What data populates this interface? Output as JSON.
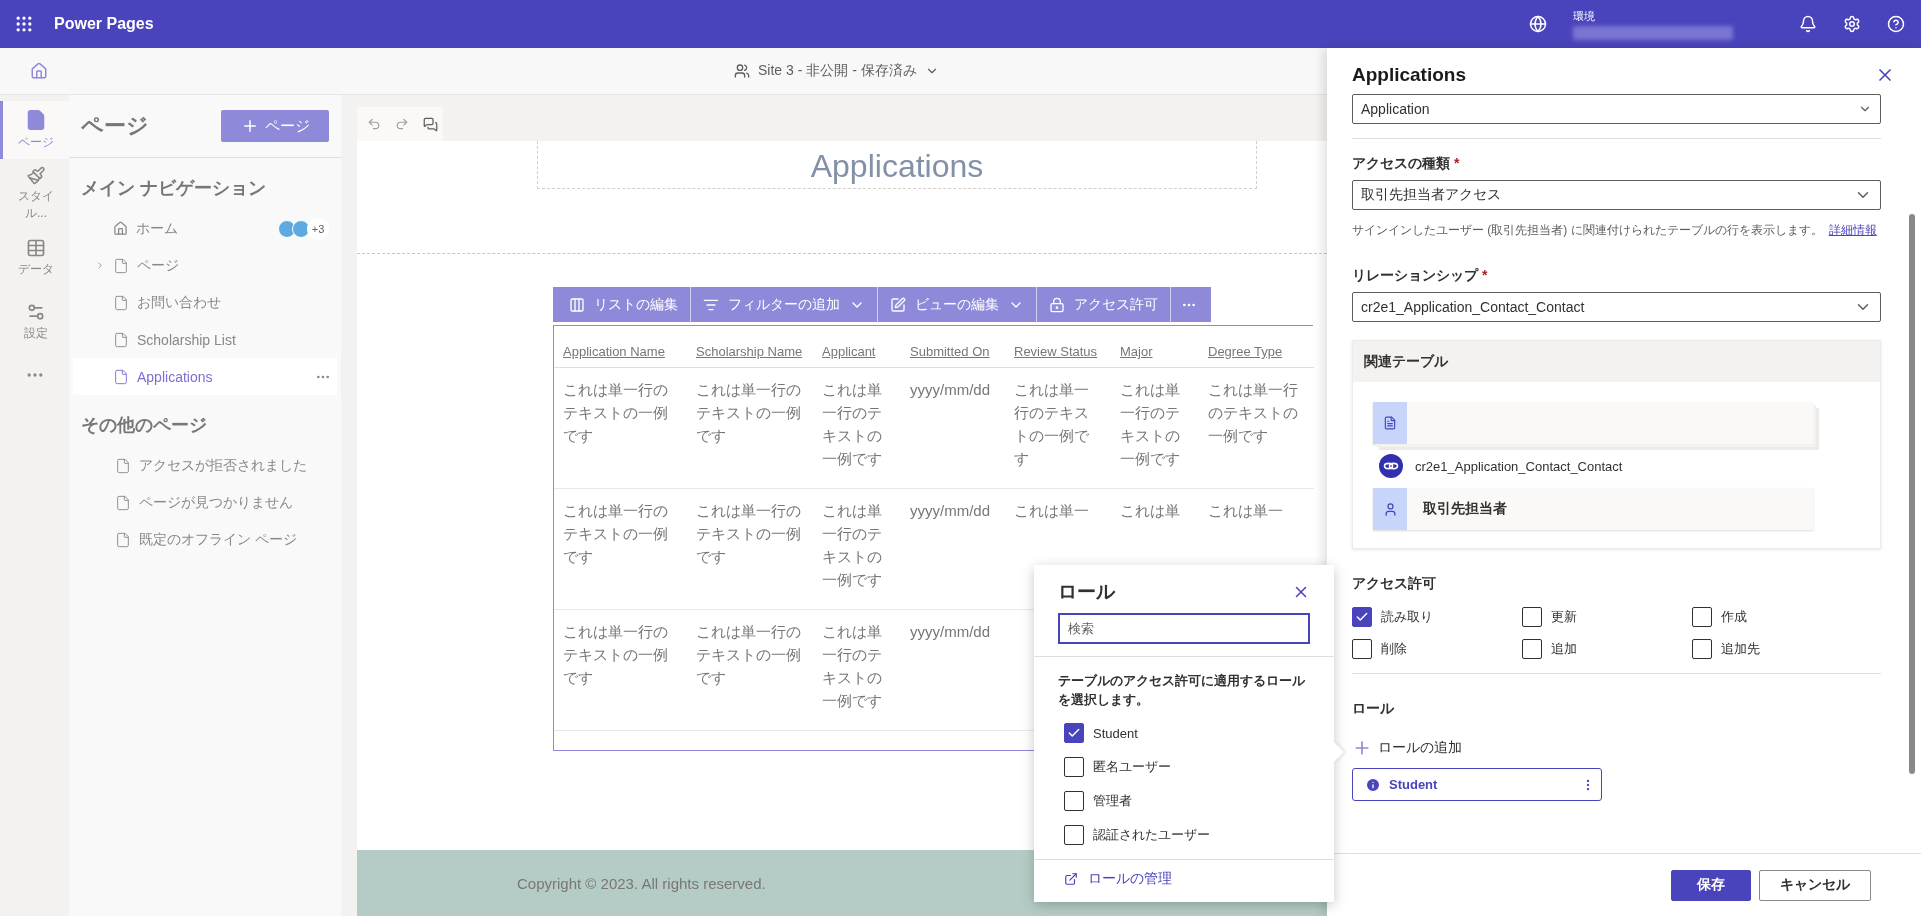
{
  "top_bar": {
    "app_title": "Power Pages",
    "environment_label": "環境"
  },
  "subheader": {
    "site_status": "Site 3 - 非公開 - 保存済み"
  },
  "rail": [
    {
      "label": "ページ",
      "selected": true
    },
    {
      "label": "スタイル...",
      "selected": false
    },
    {
      "label": "データ",
      "selected": false
    },
    {
      "label": "設定",
      "selected": false
    }
  ],
  "pages_panel": {
    "title": "ページ",
    "add_button": "ページ",
    "sections": [
      {
        "heading": "メイン ナビゲーション",
        "items": [
          {
            "label": "ホーム",
            "kind": "home",
            "selected": false,
            "presence": "+3"
          },
          {
            "label": "ページ",
            "kind": "page",
            "selected": false,
            "expanded": false
          },
          {
            "label": "お問い合わせ",
            "kind": "page",
            "selected": false
          },
          {
            "label": "Scholarship List",
            "kind": "page",
            "selected": false
          },
          {
            "label": "Applications",
            "kind": "page",
            "selected": true
          }
        ]
      },
      {
        "heading": "その他のページ",
        "items": [
          {
            "label": "アクセスが拒否されました",
            "kind": "page",
            "selected": false
          },
          {
            "label": "ページが見つかりません",
            "kind": "page",
            "selected": false
          },
          {
            "label": "既定のオフライン ページ",
            "kind": "page",
            "selected": false
          }
        ]
      }
    ]
  },
  "canvas": {
    "page_heading": "Applications",
    "list_toolbar": [
      {
        "label": "リストの編集",
        "dropdown": false
      },
      {
        "label": "フィルターの追加",
        "dropdown": true
      },
      {
        "label": "ビューの編集",
        "dropdown": true
      },
      {
        "label": "アクセス許可",
        "dropdown": false
      }
    ],
    "table": {
      "columns": [
        "Application Name",
        "Scholarship Name",
        "Applicant",
        "Submitted On",
        "Review Status",
        "Major",
        "Degree Type"
      ],
      "rows": [
        {
          "cells": [
            "これは単一行のテキストの一例です",
            "これは単一行のテキストの一例です",
            "これは単一行のテキストの一例です",
            "yyyy/mm/dd",
            "これは単一行のテキストの一例です",
            "これは単一行のテキストの一例です",
            "これは単一行のテキストの一例です"
          ]
        },
        {
          "cells": [
            "これは単一行のテキストの一例です",
            "これは単一行のテキストの一例です",
            "これは単一行のテキストの一例です",
            "yyyy/mm/dd",
            "これは単一",
            "これは単",
            "これは単一"
          ]
        },
        {
          "cells": [
            "これは単一行のテキストの一例です",
            "これは単一行のテキストの一例です",
            "これは単一行のテキストの一例です",
            "yyyy/mm/dd"
          ]
        }
      ]
    },
    "footer": "Copyright © 2023. All rights reserved."
  },
  "roles_popup": {
    "title": "ロール",
    "search_placeholder": "検索",
    "description": "テーブルのアクセス許可に適用するロールを選択します。",
    "roles": [
      {
        "label": "Student",
        "checked": true
      },
      {
        "label": "匿名ユーザー",
        "checked": false
      },
      {
        "label": "管理者",
        "checked": false
      },
      {
        "label": "認証されたユーザー",
        "checked": false
      }
    ],
    "manage_link": "ロールの管理"
  },
  "side_panel": {
    "title": "Applications",
    "table_field_value": "Application",
    "access_type": {
      "label": "アクセスの種類",
      "required_mark": "*",
      "value": "取引先担当者アクセス"
    },
    "access_help": "サインインしたユーザー (取引先担当者) に関連付けられたテーブルの行を表示します。",
    "help_link": "詳細情報",
    "relationship": {
      "label": "リレーションシップ",
      "required_mark": "*",
      "value": "cr2e1_Application_Contact_Contact"
    },
    "related_tables": {
      "title": "関連テーブル",
      "relationship_name": "cr2e1_Application_Contact_Contact",
      "target_table": "取引先担当者"
    },
    "permissions": {
      "title": "アクセス許可",
      "items": [
        {
          "label": "読み取り",
          "checked": true
        },
        {
          "label": "更新",
          "checked": false
        },
        {
          "label": "作成",
          "checked": false
        },
        {
          "label": "削除",
          "checked": false
        },
        {
          "label": "追加",
          "checked": false
        },
        {
          "label": "追加先",
          "checked": false
        }
      ]
    },
    "roles": {
      "title": "ロール",
      "add_button": "ロールの追加",
      "assigned": [
        {
          "label": "Student"
        }
      ]
    },
    "buttons": [
      {
        "label": "保存",
        "kind": "primary"
      },
      {
        "label": "キャンセル",
        "kind": "secondary"
      }
    ]
  }
}
